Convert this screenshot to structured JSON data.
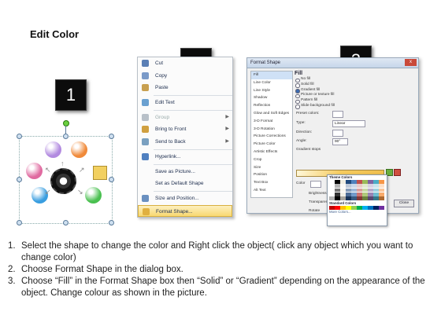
{
  "title": "Edit Color",
  "badges": [
    "1",
    "2",
    "3"
  ],
  "menu": {
    "items": [
      {
        "label": "Cut",
        "icon": "scissors-icon",
        "color": "#5a7fb5"
      },
      {
        "label": "Copy",
        "icon": "copy-icon",
        "color": "#7a9ac8"
      },
      {
        "label": "Paste",
        "icon": "paste-icon",
        "color": "#c8a050"
      },
      {
        "label": "Edit Text",
        "icon": "edit-text-icon",
        "color": "#6aa0d0"
      },
      {
        "label": "Group",
        "icon": "group-icon",
        "color": "#b8c0c8",
        "disabled": true,
        "submenu": true
      },
      {
        "label": "Bring to Front",
        "icon": "bring-to-front-icon",
        "color": "#d0a040",
        "submenu": true
      },
      {
        "label": "Send to Back",
        "icon": "send-to-back-icon",
        "color": "#7aa0c0",
        "submenu": true
      },
      {
        "label": "Hyperlink...",
        "icon": "hyperlink-icon",
        "color": "#5080c0"
      },
      {
        "label": "Save as Picture...",
        "icon": "",
        "color": ""
      },
      {
        "label": "Set as Default Shape",
        "icon": "",
        "color": ""
      },
      {
        "label": "Size and Position...",
        "icon": "size-position-icon",
        "color": "#6a90c0"
      },
      {
        "label": "Format Shape...",
        "icon": "format-shape-icon",
        "color": "#e0b040",
        "highlighted": true
      }
    ]
  },
  "dialog": {
    "title": "Format Shape",
    "close": "x",
    "nav": [
      "Fill",
      "Line Color",
      "Line Style",
      "Shadow",
      "Reflection",
      "Glow and Soft Edges",
      "3-D Format",
      "3-D Rotation",
      "Picture Corrections",
      "Picture Color",
      "Artistic Effects",
      "Crop",
      "Size",
      "Position",
      "Text Box",
      "Alt Text"
    ],
    "heading": "Fill",
    "options": [
      {
        "label": "No fill",
        "on": false
      },
      {
        "label": "Solid fill",
        "on": false
      },
      {
        "label": "Gradient fill",
        "on": true
      },
      {
        "label": "Picture or texture fill",
        "on": false
      },
      {
        "label": "Pattern fill",
        "on": false
      },
      {
        "label": "Slide background fill",
        "on": false
      }
    ],
    "preset_colors": "Preset colors:",
    "type_label": "Type:",
    "type_value": "Linear",
    "direction_label": "Direction:",
    "angle_label": "Angle:",
    "angle_value": "90°",
    "stops_label": "Gradient stops",
    "color_label": "Color",
    "position_label": "Position:",
    "position_value": "0%",
    "brightness_label": "Brightness",
    "transparency_label": "Transparency",
    "rotate_label": "Rotate",
    "close_button": "Close"
  },
  "palette": {
    "theme_label": "Theme Colors",
    "standard_label": "Standard Colors",
    "more_label": "More Colors...",
    "theme_top": [
      "#ffffff",
      "#000000",
      "#eeece1",
      "#1f497d",
      "#4f81bd",
      "#c0504d",
      "#9bbb59",
      "#8064a2",
      "#4bacc6",
      "#f79646"
    ],
    "standard": [
      "#c00000",
      "#ff0000",
      "#ffc000",
      "#ffff00",
      "#92d050",
      "#00b050",
      "#00b0f0",
      "#0070c0",
      "#002060",
      "#7030a0"
    ]
  },
  "diagram": {
    "balls": [
      {
        "color": "#b28ae0"
      },
      {
        "color": "#f08a3a"
      },
      {
        "color": "#e06aa0"
      },
      {
        "color": "#3a9ee0"
      },
      {
        "color": "#4ac050"
      }
    ]
  },
  "instructions": [
    {
      "num": "1.",
      "text": "Select the shape to change the color and Right click the object( click any object which you want to change color)"
    },
    {
      "num": "2.",
      "text": "Choose Format Shape in the dialog box."
    },
    {
      "num": "3.",
      "text": "Choose “Fill” in the Format Shape box then “Solid” or “Gradient” depending on the appearance of the object. Change colour as shown in the picture."
    }
  ]
}
